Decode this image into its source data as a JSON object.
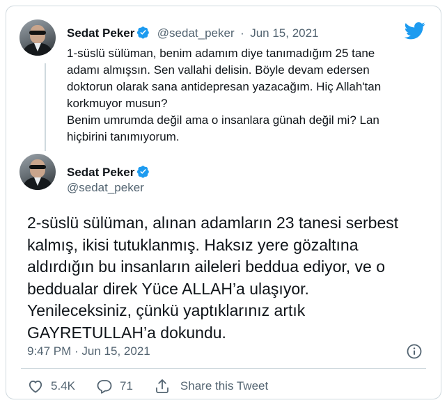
{
  "colors": {
    "accent": "#1d9bf0",
    "text": "#0f1419",
    "muted": "#536471",
    "border": "#cfd9de"
  },
  "icons": {
    "logo": "twitter-bird-icon",
    "verified": "verified-badge-icon",
    "info": "info-icon",
    "like": "heart-icon",
    "reply": "reply-bubble-icon",
    "share": "share-upload-icon"
  },
  "parent_tweet": {
    "author_name": "Sedat Peker",
    "author_handle": "@sedat_peker",
    "separator": "·",
    "date": "Jun 15, 2021",
    "lines": [
      "1-süslü sülüman, benim adamım diye tanımadığım 25 tane",
      "adamı almışsın. Sen vallahi delisin. Böyle devam edersen",
      "doktorun olarak sana antidepresan yazacağım. Hiç Allah'tan",
      "korkmuyor musun?",
      "Benim umrumda değil ama o insanlara günah değil mi? Lan",
      "hiçbirini tanımıyorum."
    ]
  },
  "main_tweet": {
    "author_name": "Sedat Peker",
    "author_handle": "@sedat_peker",
    "lines": [
      "2-süslü sülüman, alınan adamların 23 tanesi serbest",
      "kalmış, ikisi tutuklanmış. Haksız yere gözaltına",
      "aldırdığın bu insanların aileleri beddua ediyor, ve o",
      "beddualar direk Yüce ALLAH’a ulaşıyor.",
      "Yenileceksiniz, çünkü yaptıklarınız artık",
      "GAYRETULLAH’a dokundu."
    ],
    "timestamp": "9:47 PM · Jun 15, 2021",
    "likes": "5.4K",
    "replies": "71",
    "share_label": "Share this Tweet"
  }
}
